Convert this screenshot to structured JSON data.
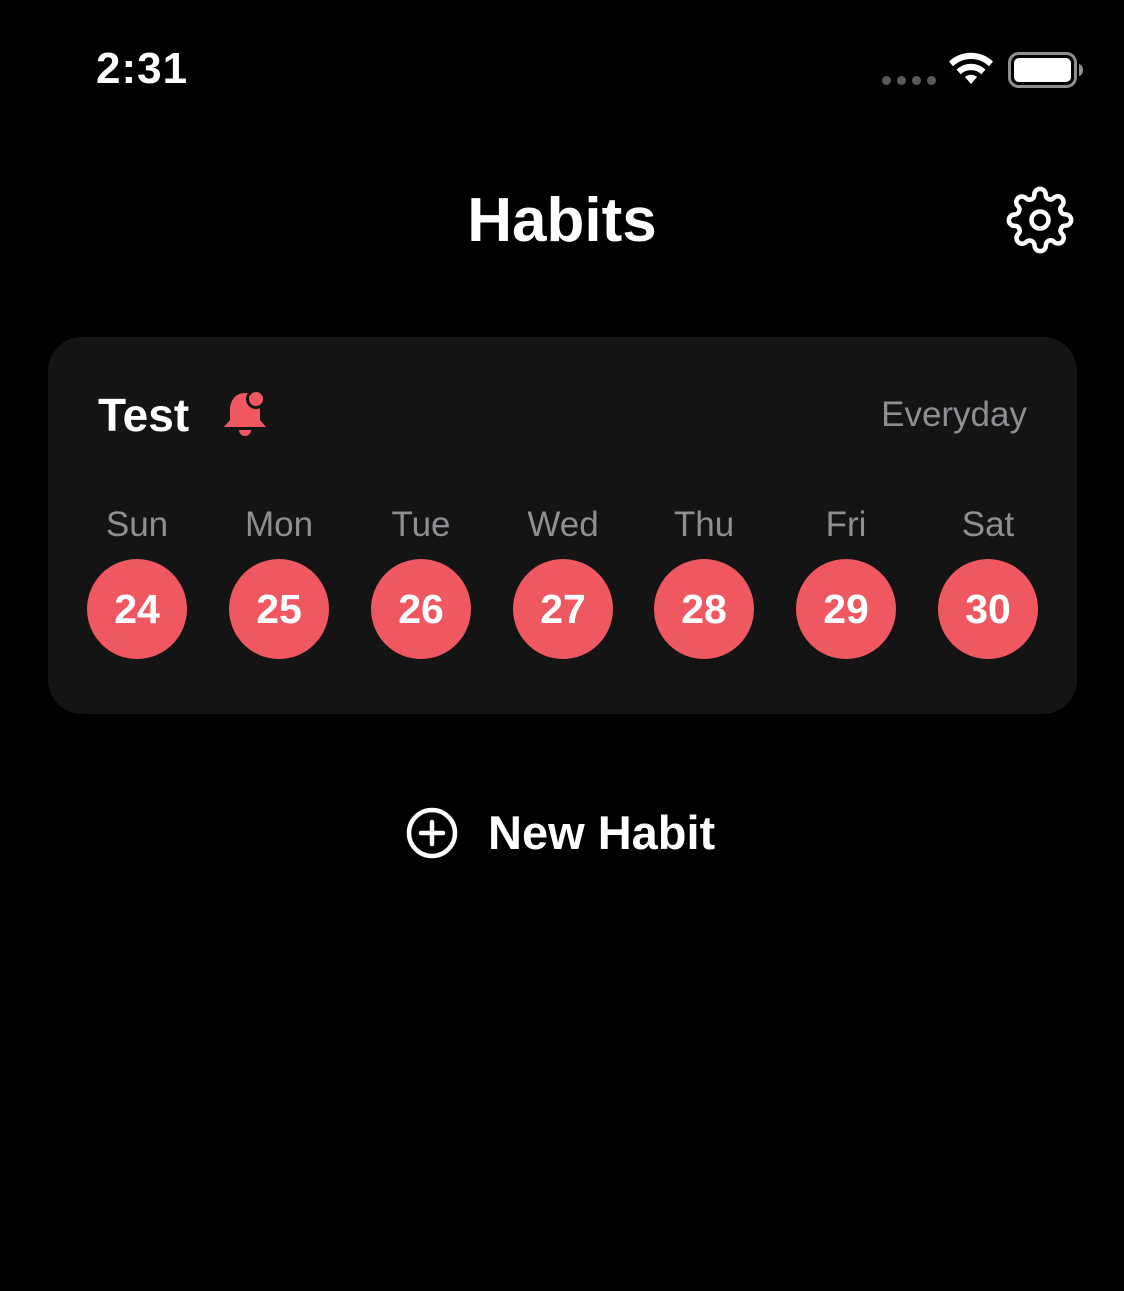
{
  "status_bar": {
    "time": "2:31",
    "icons": [
      "cellular-signal-icon",
      "wifi-icon",
      "battery-icon"
    ]
  },
  "header": {
    "title": "Habits",
    "settings_icon": "gear-icon"
  },
  "habit": {
    "name": "Test",
    "reminder_icon": "bell-badge-icon",
    "frequency": "Everyday",
    "days": [
      {
        "label": "Sun",
        "date": "24",
        "completed": true
      },
      {
        "label": "Mon",
        "date": "25",
        "completed": true
      },
      {
        "label": "Tue",
        "date": "26",
        "completed": true
      },
      {
        "label": "Wed",
        "date": "27",
        "completed": true
      },
      {
        "label": "Thu",
        "date": "28",
        "completed": true
      },
      {
        "label": "Fri",
        "date": "29",
        "completed": true
      },
      {
        "label": "Sat",
        "date": "30",
        "completed": true
      }
    ]
  },
  "new_habit": {
    "label": "New Habit",
    "icon": "plus-circle-icon"
  },
  "colors": {
    "background": "#000000",
    "card": "#141414",
    "accent": "#ef5860",
    "secondary_text": "#8e8e93",
    "primary_text": "#ffffff"
  }
}
